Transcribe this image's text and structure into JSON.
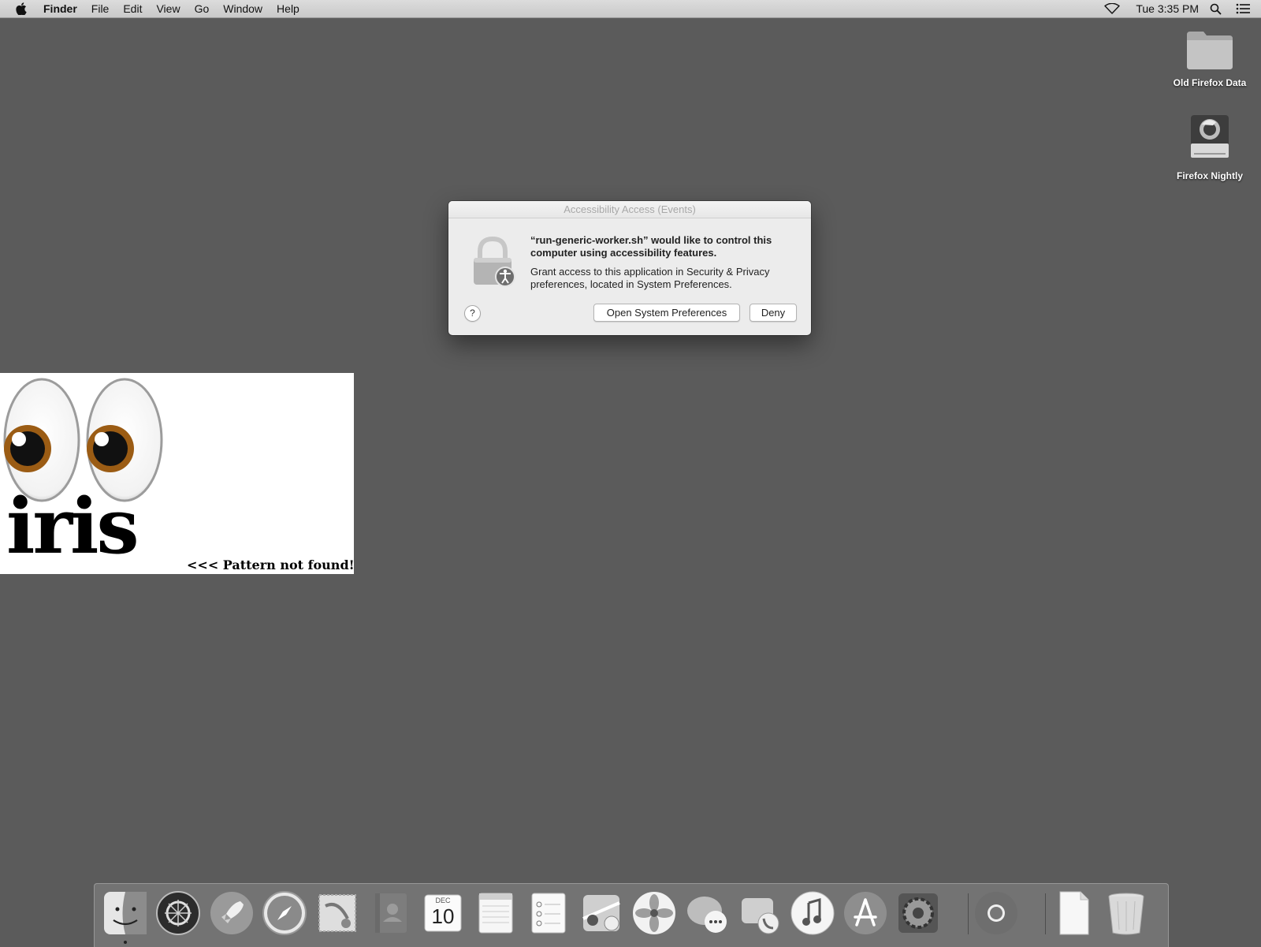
{
  "menubar": {
    "apple_icon": "apple-icon",
    "app_name": "Finder",
    "menus": [
      "File",
      "Edit",
      "View",
      "Go",
      "Window",
      "Help"
    ],
    "clock": "Tue 3:35 PM",
    "status_icons": [
      "wifi-icon",
      "spotlight-search-icon",
      "notification-center-icon"
    ]
  },
  "desktop": {
    "icons": [
      {
        "label": "Old Firefox Data",
        "icon": "folder-icon"
      },
      {
        "label": "Firefox Nightly",
        "icon": "disk-image-icon"
      }
    ]
  },
  "dialog": {
    "title": "Accessibility Access (Events)",
    "heading": "“run-generic-worker.sh” would like to control this computer using accessibility features.",
    "body": "Grant access to this application in Security & Privacy preferences, located in System Preferences.",
    "help_label": "?",
    "open_button": "Open System Preferences",
    "deny_button": "Deny",
    "icon": "lock-accessibility-icon"
  },
  "iris_overlay": {
    "logo_text": "iris",
    "message": "<<< Pattern not found!"
  },
  "dock": {
    "apps": [
      "finder-icon",
      "siri-icon",
      "launchpad-icon",
      "safari-icon",
      "mail-icon",
      "contacts-icon",
      "calendar-icon",
      "notes-icon",
      "reminders-icon",
      "maps-icon",
      "photos-icon",
      "messages-icon",
      "facetime-icon",
      "itunes-icon",
      "app-store-icon",
      "system-preferences-icon",
      "chrome-icon",
      "document-icon",
      "trash-icon"
    ],
    "calendar_month": "DEC",
    "calendar_day": "10"
  },
  "colors": {
    "desktop": "#5b5b5b",
    "menubar": "#d5d5d5",
    "dialog": "#ececec"
  }
}
